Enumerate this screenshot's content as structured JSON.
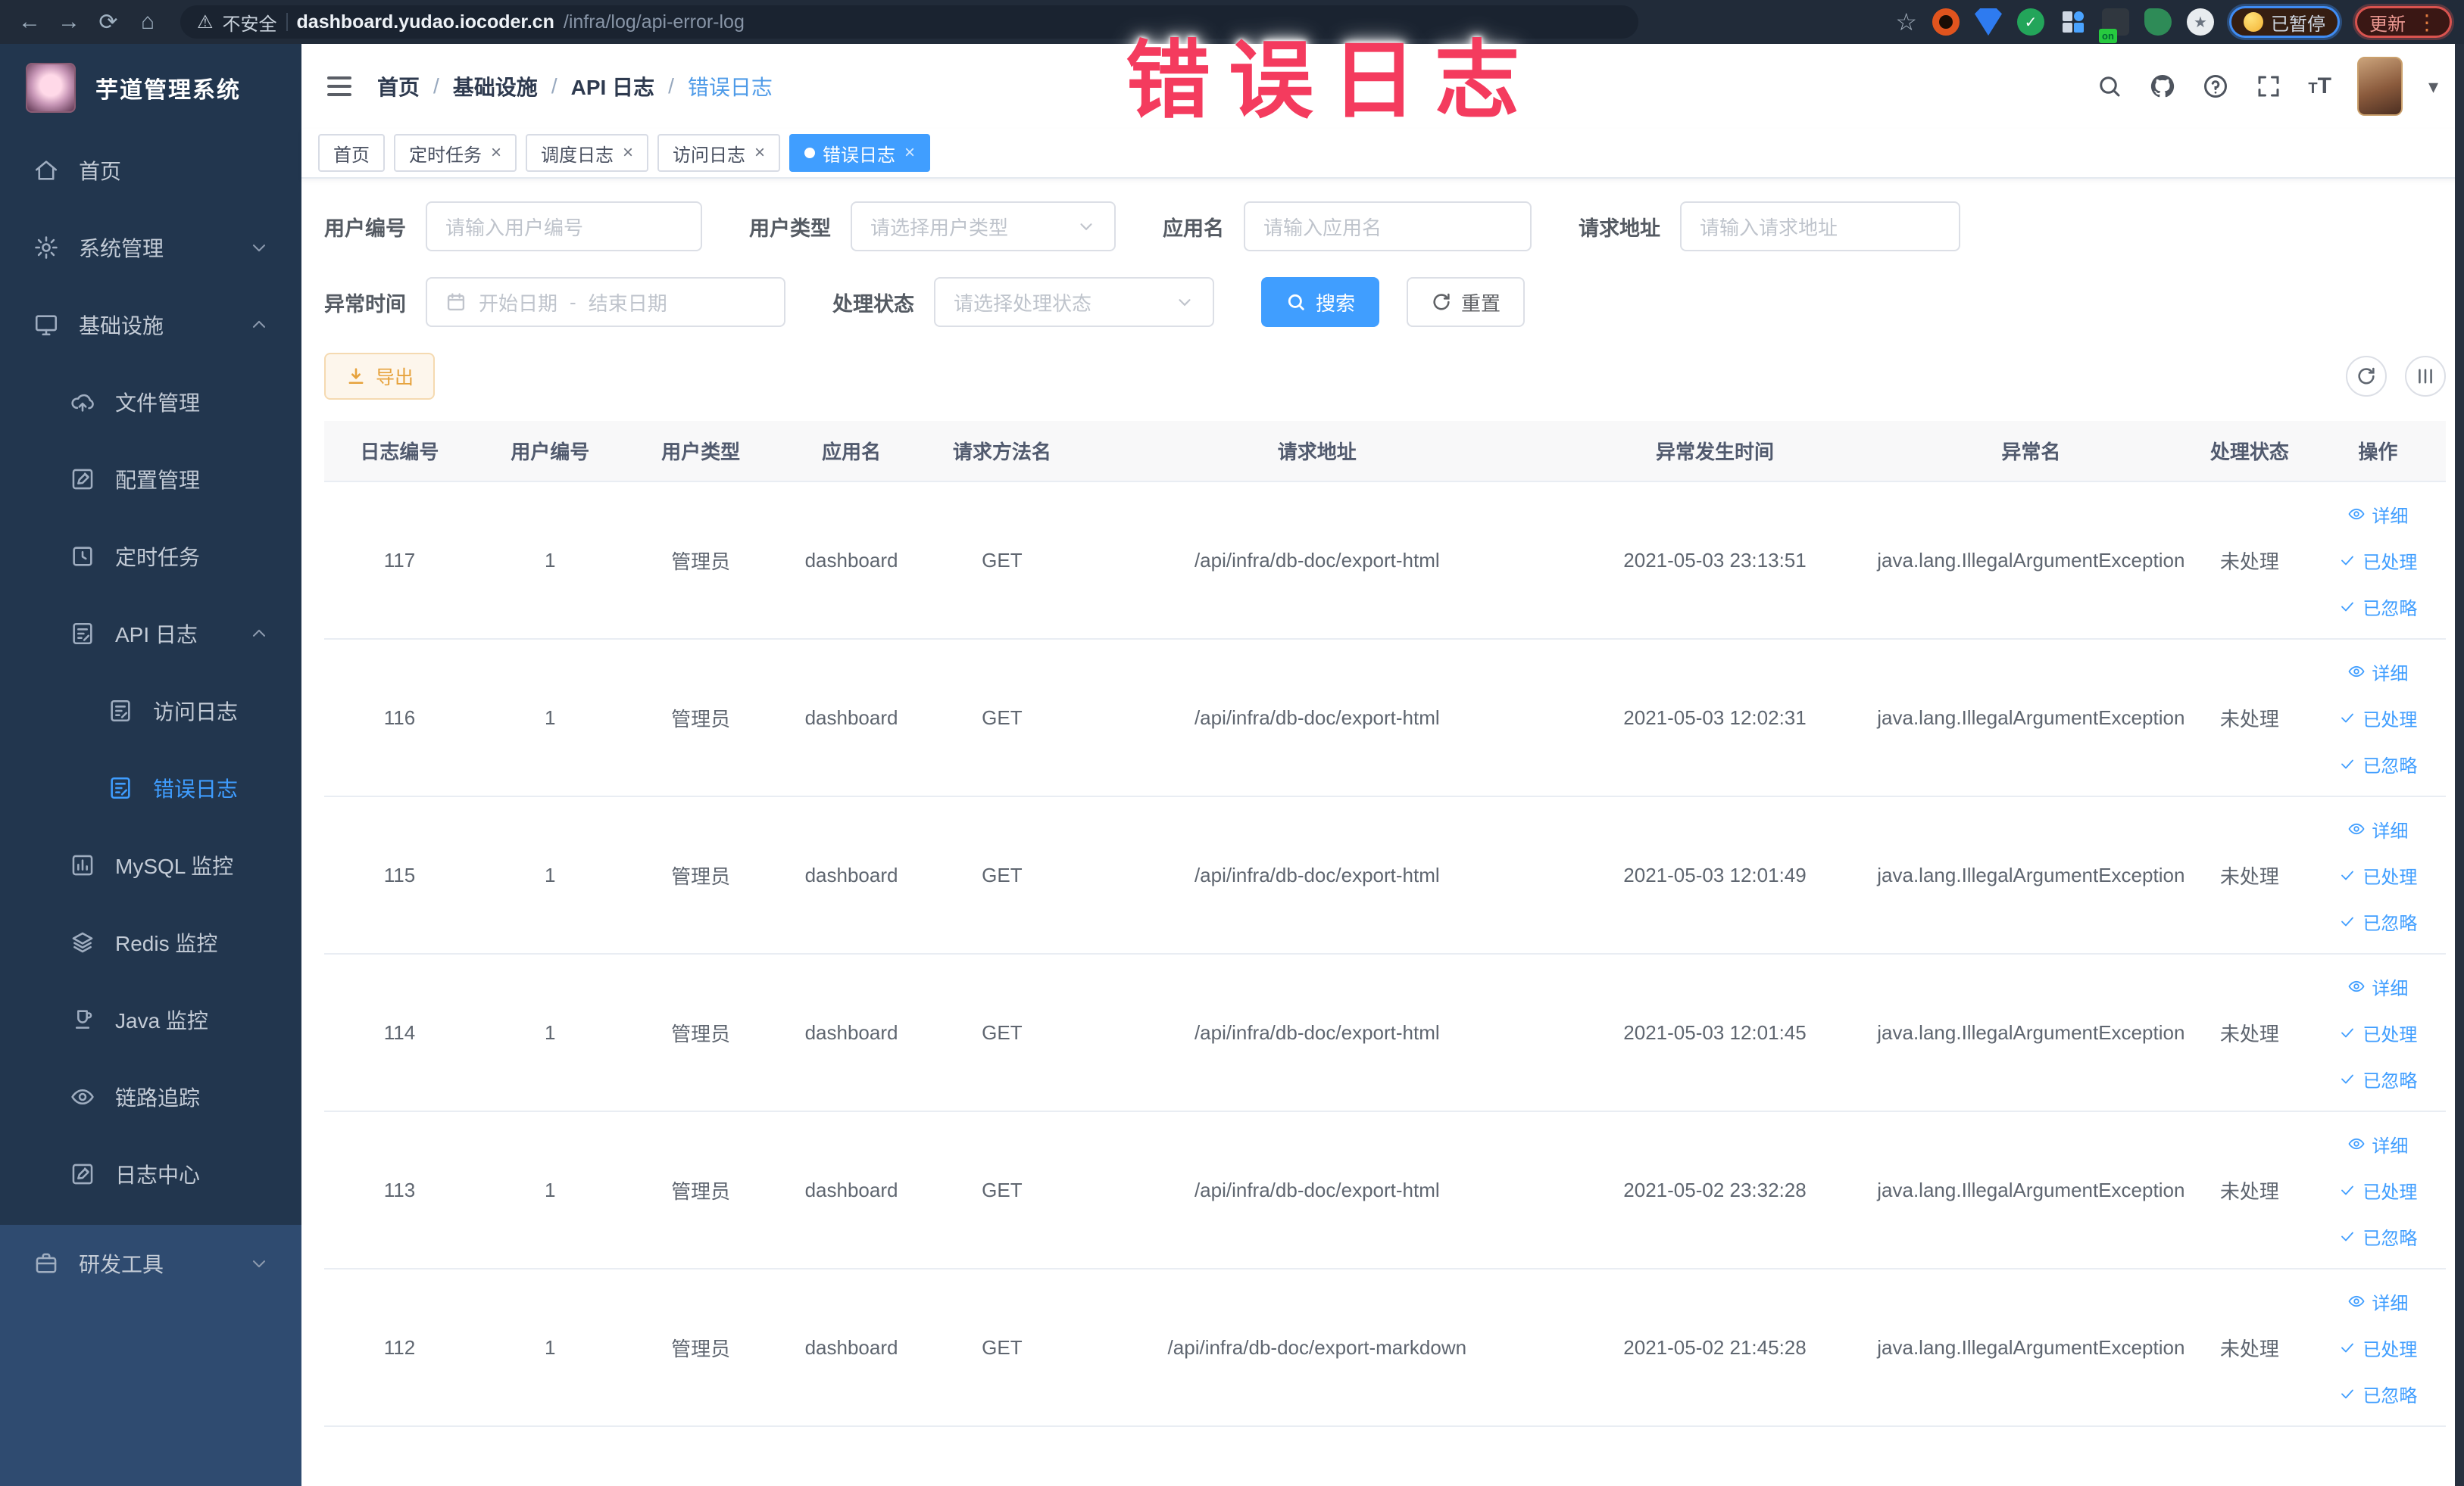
{
  "browser": {
    "security_warning": "不安全",
    "url_host": "dashboard.yudao.iocoder.cn",
    "url_path": "/infra/log/api-error-log",
    "paused_badge": "已暂停",
    "update_badge": "更新"
  },
  "overlay": {
    "text": "错误日志"
  },
  "sidebar": {
    "app_title": "芋道管理系统",
    "items": [
      {
        "label": "首页",
        "icon": "home-icon",
        "level": 1,
        "chevron": null,
        "active": false,
        "zone": "dark"
      },
      {
        "label": "系统管理",
        "icon": "gear-icon",
        "level": 1,
        "chevron": "down",
        "active": false,
        "zone": "dark"
      },
      {
        "label": "基础设施",
        "icon": "monitor-icon",
        "level": 1,
        "chevron": "up",
        "active": false,
        "zone": "dark"
      },
      {
        "label": "文件管理",
        "icon": "cloud-upload-icon",
        "level": 2,
        "chevron": null,
        "active": false,
        "zone": "dark"
      },
      {
        "label": "配置管理",
        "icon": "edit-icon",
        "level": 2,
        "chevron": null,
        "active": false,
        "zone": "dark"
      },
      {
        "label": "定时任务",
        "icon": "schedule-icon",
        "level": 2,
        "chevron": null,
        "active": false,
        "zone": "dark"
      },
      {
        "label": "API 日志",
        "icon": "log-icon",
        "level": 2,
        "chevron": "up",
        "active": false,
        "zone": "dark"
      },
      {
        "label": "访问日志",
        "icon": "log-icon",
        "level": 3,
        "chevron": null,
        "active": false,
        "zone": "dark"
      },
      {
        "label": "错误日志",
        "icon": "log-icon",
        "level": 3,
        "chevron": null,
        "active": true,
        "zone": "dark"
      },
      {
        "label": "MySQL 监控",
        "icon": "chart-icon",
        "level": 2,
        "chevron": null,
        "active": false,
        "zone": "dark"
      },
      {
        "label": "Redis 监控",
        "icon": "layers-icon",
        "level": 2,
        "chevron": null,
        "active": false,
        "zone": "dark"
      },
      {
        "label": "Java 监控",
        "icon": "java-icon",
        "level": 2,
        "chevron": null,
        "active": false,
        "zone": "dark"
      },
      {
        "label": "链路追踪",
        "icon": "eye-icon",
        "level": 2,
        "chevron": null,
        "active": false,
        "zone": "dark"
      },
      {
        "label": "日志中心",
        "icon": "edit-icon",
        "level": 2,
        "chevron": null,
        "active": false,
        "zone": "dark"
      },
      {
        "label": "研发工具",
        "icon": "tools-icon",
        "level": 1,
        "chevron": "down",
        "active": false,
        "zone": "light"
      }
    ]
  },
  "breadcrumb": [
    "首页",
    "基础设施",
    "API 日志",
    "错误日志"
  ],
  "tabs": [
    {
      "label": "首页",
      "closable": false,
      "active": false
    },
    {
      "label": "定时任务",
      "closable": true,
      "active": false
    },
    {
      "label": "调度日志",
      "closable": true,
      "active": false
    },
    {
      "label": "访问日志",
      "closable": true,
      "active": false
    },
    {
      "label": "错误日志",
      "closable": true,
      "active": true
    }
  ],
  "filters": {
    "user_id": {
      "label": "用户编号",
      "placeholder": "请输入用户编号"
    },
    "user_type": {
      "label": "用户类型",
      "placeholder": "请选择用户类型"
    },
    "app_name": {
      "label": "应用名",
      "placeholder": "请输入应用名"
    },
    "request_url": {
      "label": "请求地址",
      "placeholder": "请输入请求地址"
    },
    "exception_time": {
      "label": "异常时间",
      "start_placeholder": "开始日期",
      "end_placeholder": "结束日期"
    },
    "process_status": {
      "label": "处理状态",
      "placeholder": "请选择处理状态"
    },
    "search_label": "搜索",
    "reset_label": "重置"
  },
  "toolbar": {
    "export_label": "导出"
  },
  "table": {
    "headers": [
      "日志编号",
      "用户编号",
      "用户类型",
      "应用名",
      "请求方法名",
      "请求地址",
      "异常发生时间",
      "异常名",
      "处理状态",
      "操作"
    ],
    "actions": [
      {
        "label": "详细",
        "icon": "eye-small-icon"
      },
      {
        "label": "已处理",
        "icon": "check-icon"
      },
      {
        "label": "已忽略",
        "icon": "check-icon"
      }
    ],
    "rows": [
      {
        "cells": [
          "117",
          "1",
          "管理员",
          "dashboard",
          "GET",
          "/api/infra/db-doc/export-html",
          "2021-05-03 23:13:51",
          "java.lang.IllegalArgumentException",
          "未处理"
        ]
      },
      {
        "cells": [
          "116",
          "1",
          "管理员",
          "dashboard",
          "GET",
          "/api/infra/db-doc/export-html",
          "2021-05-03 12:02:31",
          "java.lang.IllegalArgumentException",
          "未处理"
        ]
      },
      {
        "cells": [
          "115",
          "1",
          "管理员",
          "dashboard",
          "GET",
          "/api/infra/db-doc/export-html",
          "2021-05-03 12:01:49",
          "java.lang.IllegalArgumentException",
          "未处理"
        ]
      },
      {
        "cells": [
          "114",
          "1",
          "管理员",
          "dashboard",
          "GET",
          "/api/infra/db-doc/export-html",
          "2021-05-03 12:01:45",
          "java.lang.IllegalArgumentException",
          "未处理"
        ]
      },
      {
        "cells": [
          "113",
          "1",
          "管理员",
          "dashboard",
          "GET",
          "/api/infra/db-doc/export-html",
          "2021-05-02 23:32:28",
          "java.lang.IllegalArgumentException",
          "未处理"
        ]
      },
      {
        "cells": [
          "112",
          "1",
          "管理员",
          "dashboard",
          "GET",
          "/api/infra/db-doc/export-markdown",
          "2021-05-02 21:45:28",
          "java.lang.IllegalArgumentException",
          "未处理"
        ]
      }
    ]
  },
  "ui": {
    "close_glyph": "×",
    "breadcrumb_separator": "/",
    "range_separator": "-"
  },
  "colors": {
    "accent": "#409eff",
    "warning": "#e6a23c",
    "stamp": "#f43b5e",
    "sidebar_dark": "#22364e",
    "sidebar_light": "#2f4b70"
  }
}
